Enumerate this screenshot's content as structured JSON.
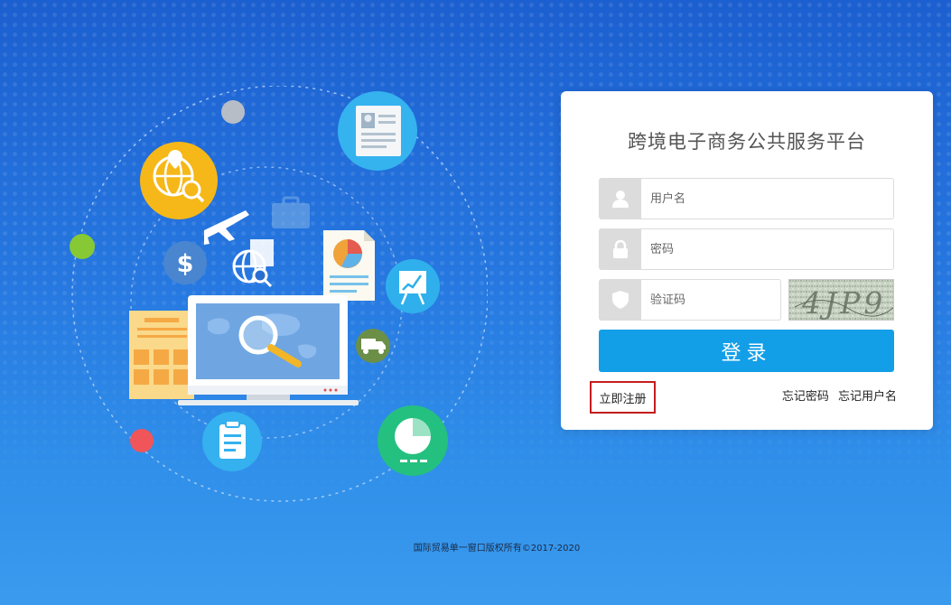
{
  "platform": {
    "title": "跨境电子商务公共服务平台"
  },
  "login": {
    "username_placeholder": "用户名",
    "password_placeholder": "密码",
    "captcha_placeholder": "验证码",
    "captcha_text": "4JP9",
    "submit_label": "登录",
    "register_label": "立即注册",
    "forgot_password_label": "忘记密码",
    "forgot_username_label": "忘记用户名"
  },
  "footer": {
    "copyright": "国际贸易单一窗口版权所有©2017-2020"
  },
  "colors": {
    "background": "#2677e0",
    "button": "#129fe8",
    "register_border": "#c41d1d",
    "icon_box": "#dcdcdc"
  },
  "icons": [
    "user-icon",
    "lock-icon",
    "shield-icon"
  ]
}
